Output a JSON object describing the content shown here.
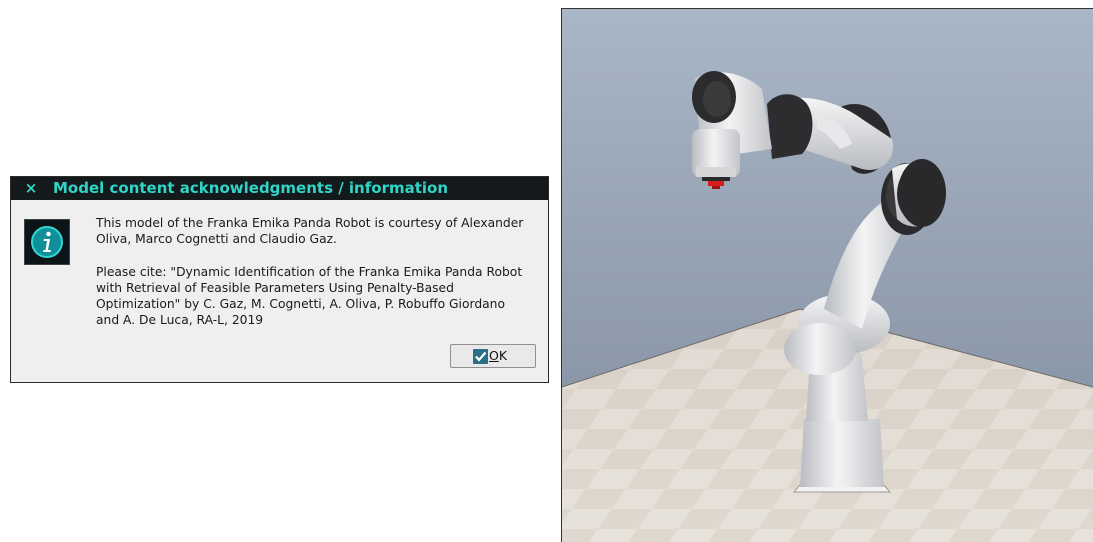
{
  "dialog": {
    "title": "Model content acknowledgments / information",
    "close_glyph": "×",
    "icon": "info-icon",
    "message_line1a": "This model of the Franka Emika Panda Robot is courtesy of Alexander",
    "message_line1b": "Oliva, Marco Cognetti and Claudio Gaz.",
    "message_line2a": "Please cite: \"Dynamic Identification of the Franka Emika Panda Robot",
    "message_line2b": "with Retrieval of Feasible Parameters Using Penalty-Based",
    "message_line2c": "Optimization\" by C. Gaz, M. Cognetti, A. Oliva, P. Robuffo Giordano",
    "message_line2d": "and A. De Luca, RA-L, 2019",
    "ok_label": "OK",
    "accent_color": "#2fd6c8",
    "titlebar_color": "#141a1c"
  },
  "viewport": {
    "content": "robot-arm-3d-view",
    "background_color": "#8d9aab"
  }
}
